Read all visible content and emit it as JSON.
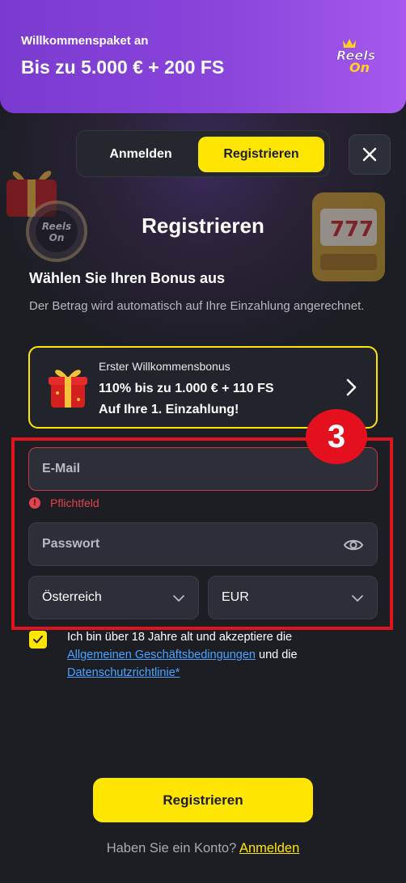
{
  "promo": {
    "subtitle": "Willkommenspaket an",
    "title": "Bis zu 5.000 € + 200 FS",
    "logo_text_top": "Reels",
    "logo_text_bottom": "On"
  },
  "tabs": {
    "login": "Anmelden",
    "register": "Registrieren",
    "active": "register"
  },
  "heading": "Registrieren",
  "bonus": {
    "section_title": "Wählen Sie Ihren Bonus aus",
    "section_desc": "Der Betrag wird automatisch auf Ihre Einzahlung angerechnet.",
    "card_label": "Erster Willkommensbonus",
    "card_line1": "110% bis zu 1.000 € + 110 FS",
    "card_line2": "Auf Ihre 1. Einzahlung!"
  },
  "annotation": {
    "step_number": "3"
  },
  "form": {
    "email_placeholder": "E-Mail",
    "email_error_icon": "!",
    "email_error": "Pflichtfeld",
    "password_placeholder": "Passwort",
    "country_value": "Österreich",
    "currency_value": "EUR",
    "terms_pre": "Ich bin über 18 Jahre alt und akzeptiere die",
    "terms_link": "Allgemeinen Geschäftsbedingungen",
    "terms_mid": " und die ",
    "privacy_link": "Datenschutzrichtlinie*",
    "terms_checked": true,
    "submit": "Registrieren"
  },
  "footer": {
    "question": "Haben Sie ein Konto?",
    "login_link": "Anmelden"
  },
  "colors": {
    "accent": "#ffe600",
    "promo_purple": "#8a45db",
    "error": "#e0424e",
    "annotation_red": "#e0141f",
    "link": "#4aa3ff",
    "background": "#1c1e24"
  },
  "icons": [
    "gift-icon",
    "close-icon",
    "chevron-right-icon",
    "eye-icon",
    "chevron-down-icon",
    "check-icon",
    "error-icon",
    "slot-machine-icon",
    "logo"
  ]
}
